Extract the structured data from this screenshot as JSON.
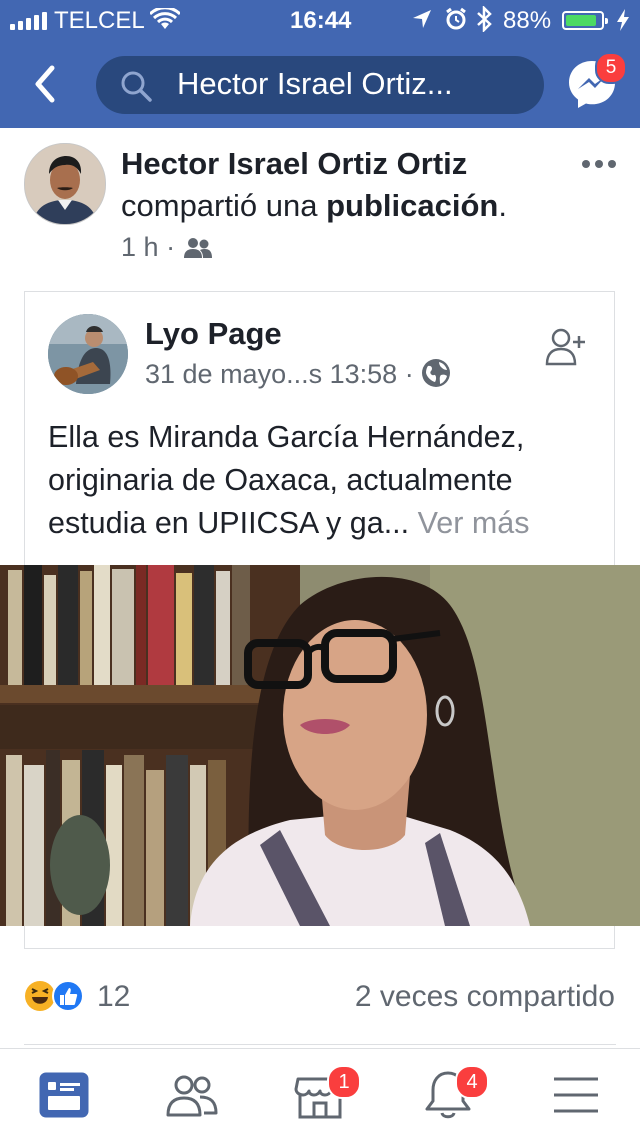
{
  "status_bar": {
    "carrier": "TELCEL",
    "time": "16:44",
    "battery_percent": "88%",
    "battery_level": 0.88
  },
  "nav": {
    "search_text": "Hector Israel Ortiz...",
    "messenger_badge": "5"
  },
  "post": {
    "author": "Hector Israel Ortiz Ortiz",
    "action_text": "compartió una",
    "action_object": "publicación",
    "action_suffix": ".",
    "time": "1 h",
    "audience_icon": "friends-icon"
  },
  "shared": {
    "author": "Lyo Page",
    "time": "31 de mayo...s 13:58",
    "audience_icon": "globe-icon",
    "body": "Ella es Miranda García Hernández, originaria de Oaxaca, actualmente estudia en UPIICSA y ga...",
    "see_more": "Ver más"
  },
  "footer": {
    "reaction_count": "12",
    "shares": "2 veces compartido"
  },
  "tabbar": {
    "marketplace_badge": "1",
    "notifications_badge": "4"
  },
  "colors": {
    "brand_blue": "#4267b2",
    "badge_red": "#fa3e3e",
    "text": "#1d2129",
    "muted": "#606770"
  }
}
